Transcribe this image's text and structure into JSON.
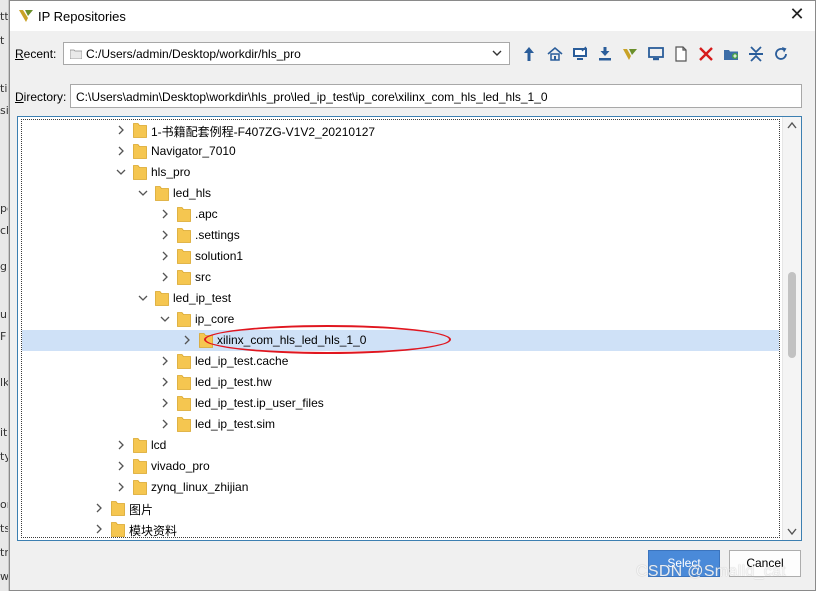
{
  "background_window": {
    "fragments": [
      "tt",
      "t",
      "ti",
      "si",
      "po",
      "ck",
      "g",
      "u",
      "F",
      "lk",
      "it",
      "ty",
      "or",
      "ts",
      "tr",
      "w"
    ]
  },
  "dialog": {
    "title": "IP Repositories",
    "close_glyph": "✕"
  },
  "recent": {
    "label_prefix": "R",
    "label_rest": "ecent:",
    "value": "C:/Users/admin/Desktop/workdir/hls_pro"
  },
  "toolbar": {
    "icons": [
      "go-up-icon",
      "home-icon",
      "desktop-open-icon",
      "download-icon",
      "vivado-project-icon",
      "monitor-icon",
      "new-file-icon",
      "delete-icon",
      "new-folder-icon",
      "collapse-all-icon",
      "refresh-icon"
    ]
  },
  "directory": {
    "label_prefix": "D",
    "label_rest": "irectory:",
    "value": "C:\\Users\\admin\\Desktop\\workdir\\hls_pro\\led_ip_test\\ip_core\\xilinx_com_hls_led_hls_1_0"
  },
  "tree": {
    "rows": [
      {
        "label": "1-书籍配套例程-F407ZG-V1V2_20210127",
        "depth": 2,
        "expanded": false
      },
      {
        "label": "Navigator_7010",
        "depth": 2,
        "expanded": false
      },
      {
        "label": "hls_pro",
        "depth": 2,
        "expanded": true
      },
      {
        "label": "led_hls",
        "depth": 3,
        "expanded": true
      },
      {
        "label": ".apc",
        "depth": 4,
        "expanded": false
      },
      {
        "label": ".settings",
        "depth": 4,
        "expanded": false
      },
      {
        "label": "solution1",
        "depth": 4,
        "expanded": false
      },
      {
        "label": "src",
        "depth": 4,
        "expanded": false
      },
      {
        "label": "led_ip_test",
        "depth": 3,
        "expanded": true
      },
      {
        "label": "ip_core",
        "depth": 4,
        "expanded": true
      },
      {
        "label": "xilinx_com_hls_led_hls_1_0",
        "depth": 5,
        "expanded": false,
        "selected": true
      },
      {
        "label": "led_ip_test.cache",
        "depth": 4,
        "expanded": false
      },
      {
        "label": "led_ip_test.hw",
        "depth": 4,
        "expanded": false
      },
      {
        "label": "led_ip_test.ip_user_files",
        "depth": 4,
        "expanded": false
      },
      {
        "label": "led_ip_test.sim",
        "depth": 4,
        "expanded": false
      },
      {
        "label": "lcd",
        "depth": 2,
        "expanded": false
      },
      {
        "label": "vivado_pro",
        "depth": 2,
        "expanded": false
      },
      {
        "label": "zynq_linux_zhijian",
        "depth": 2,
        "expanded": false
      },
      {
        "label": "图片",
        "depth": 1,
        "expanded": false
      },
      {
        "label": "模块资料",
        "depth": 1,
        "expanded": false
      }
    ]
  },
  "buttons": {
    "select": "Select",
    "cancel": "Cancel"
  },
  "watermark": "CSDN @Smalld_cat",
  "colors": {
    "selection": "#cfe1f7",
    "primary_button": "#4a8ad9",
    "annotation_ellipse": "#e0161f",
    "folder": "#f5c650"
  }
}
